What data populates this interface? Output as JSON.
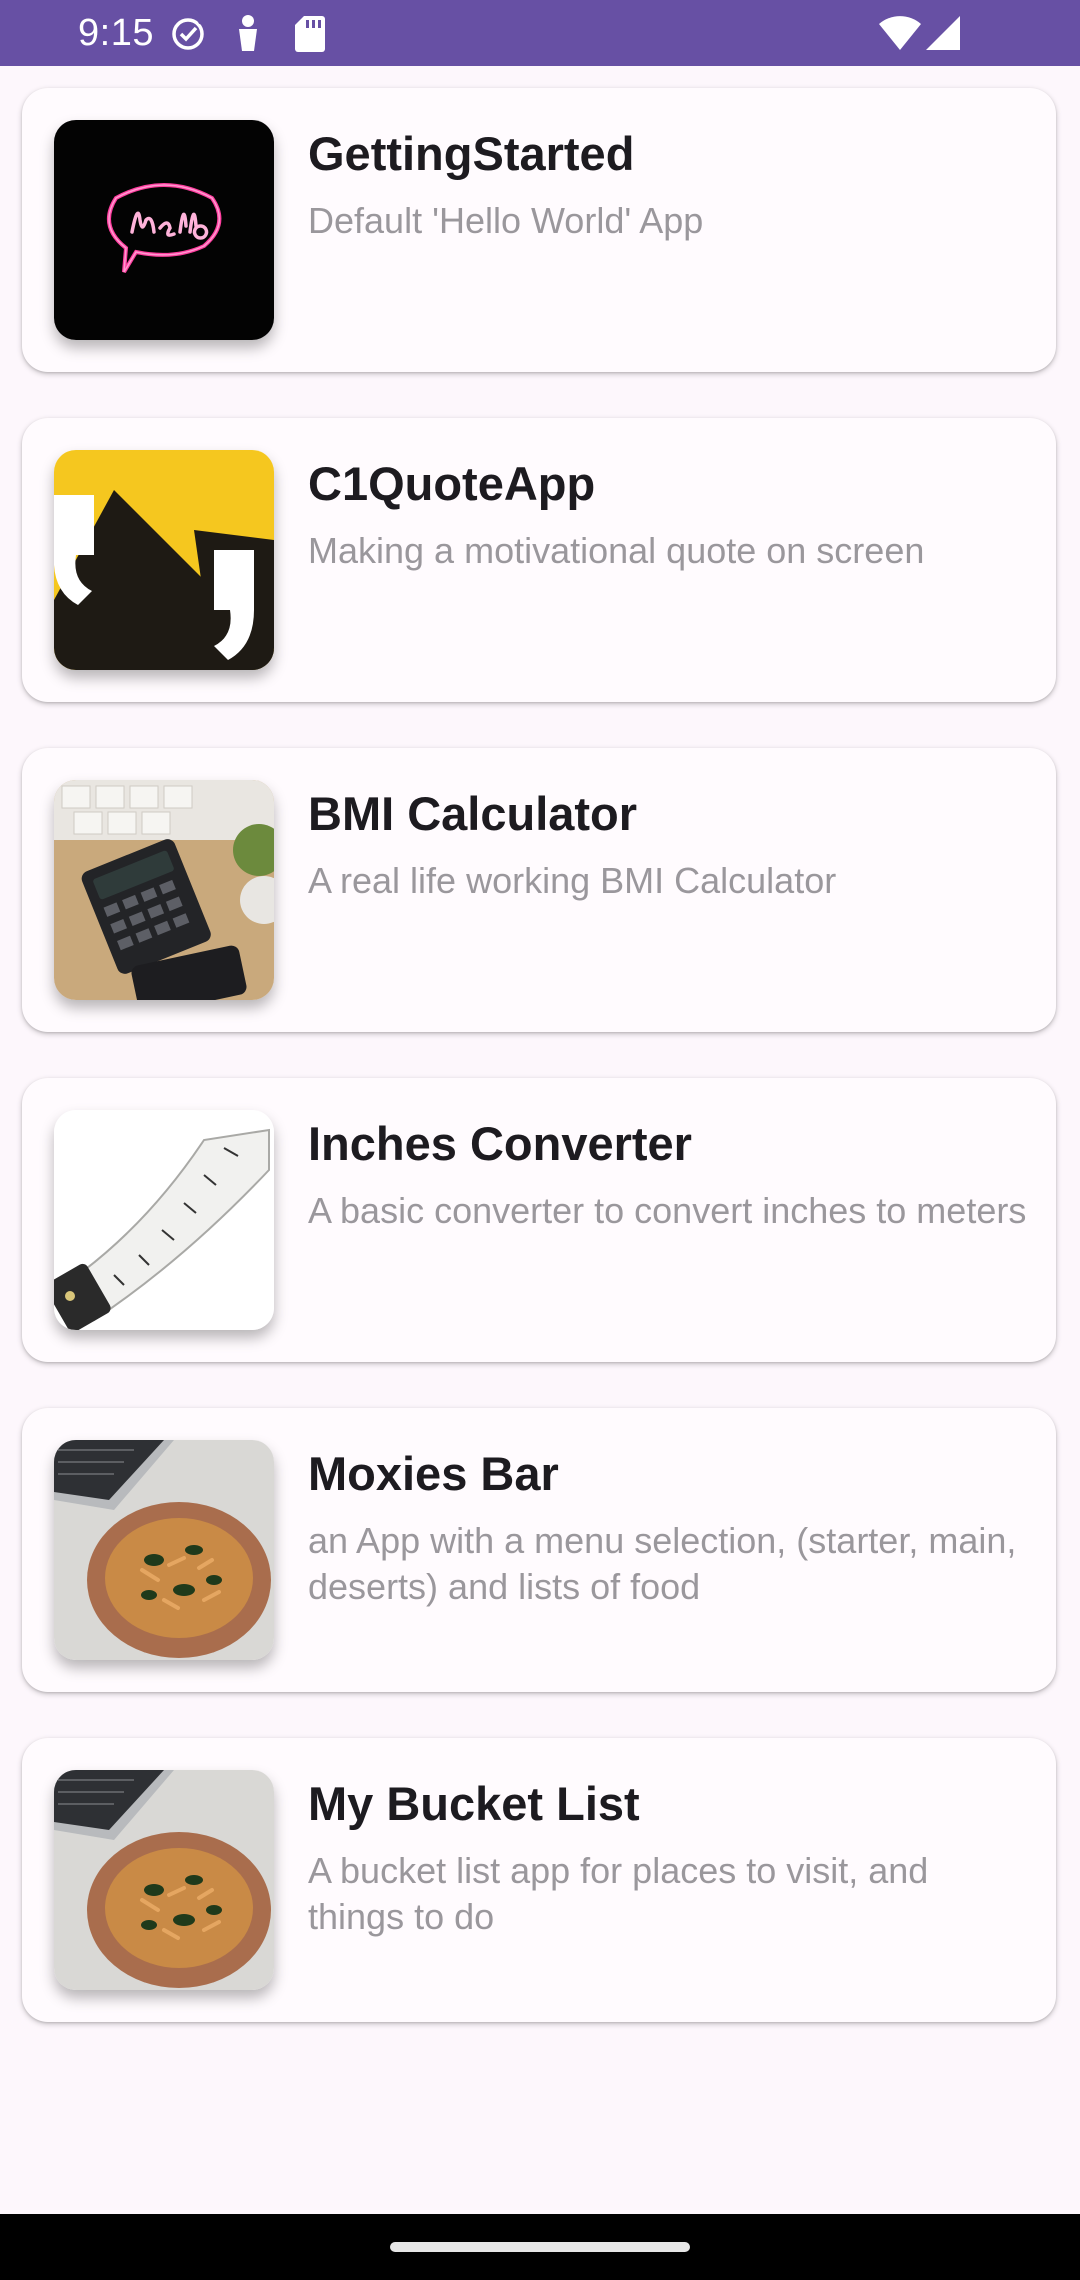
{
  "status_bar": {
    "time": "9:15",
    "icons": [
      "check-circle-icon",
      "accessibility-icon",
      "sd-card-icon",
      "wifi-icon",
      "cellular-signal-icon"
    ],
    "background": "#6750a4"
  },
  "apps": [
    {
      "title": "GettingStarted",
      "description": "Default 'Hello World' App",
      "image": "neon-hello-image"
    },
    {
      "title": "C1QuoteApp",
      "description": "Making a motivational quote on screen",
      "image": "quote-marks-image"
    },
    {
      "title": "BMI Calculator",
      "description": "A real life working BMI Calculator",
      "image": "calculator-desk-image"
    },
    {
      "title": "Inches Converter",
      "description": "A basic converter to convert inches to meters",
      "image": "tape-measure-image"
    },
    {
      "title": "Moxies Bar",
      "description": "an App with a menu selection, (starter, main, deserts) and lists of food",
      "image": "pasta-bowl-image"
    },
    {
      "title": "My Bucket List",
      "description": "A bucket list app for places to visit, and things to do",
      "image": "pasta-bowl-image"
    }
  ],
  "colors": {
    "title_text": "#1d1b20",
    "description_text": "#9a979c",
    "card_background": "#fffbfe",
    "page_background": "#fdf7fc"
  }
}
